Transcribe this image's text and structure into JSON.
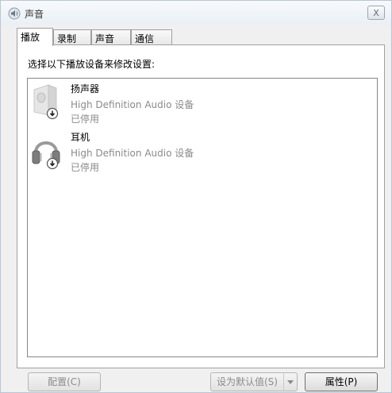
{
  "window": {
    "title": "声音",
    "close_symbol": "X"
  },
  "tabs": [
    {
      "label": "播放",
      "active": true
    },
    {
      "label": "录制",
      "active": false
    },
    {
      "label": "声音",
      "active": false
    },
    {
      "label": "通信",
      "active": false
    }
  ],
  "panel": {
    "instruction": "选择以下播放设备来修改设置:"
  },
  "devices": [
    {
      "name": "扬声器",
      "description": "High Definition Audio 设备",
      "status": "已停用",
      "icon": "speaker-icon"
    },
    {
      "name": "耳机",
      "description": "High Definition Audio 设备",
      "status": "已停用",
      "icon": "headphones-icon"
    }
  ],
  "buttons": {
    "configure": "配置(C)",
    "set_default": "设为默认值(S)",
    "properties": "属性(P)"
  },
  "colors": {
    "disabled_text": "#8a8a8a",
    "panel_bg": "#ffffff",
    "window_bg": "#f0f0f0"
  }
}
